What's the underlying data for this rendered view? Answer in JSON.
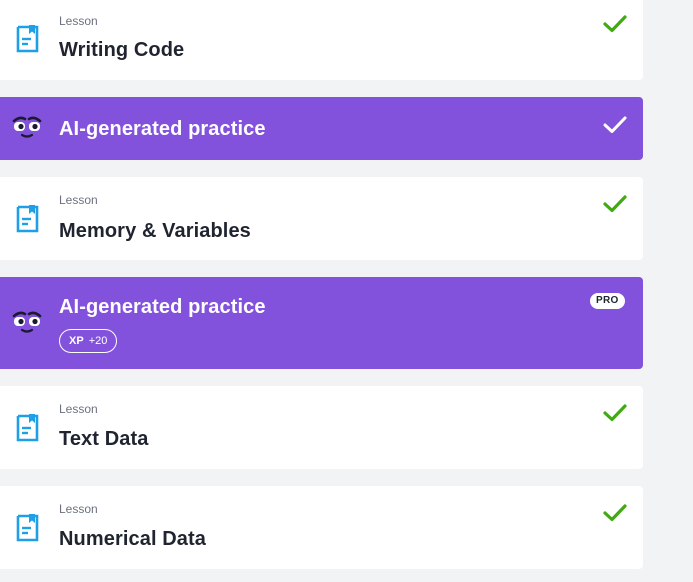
{
  "items": [
    {
      "kind": "lesson",
      "kicker": "Lesson",
      "title": "Writing Code",
      "completed": true
    },
    {
      "kind": "practice",
      "title": "AI-generated practice",
      "completed": true
    },
    {
      "kind": "lesson",
      "kicker": "Lesson",
      "title": "Memory & Variables",
      "completed": true
    },
    {
      "kind": "practice",
      "title": "AI-generated practice",
      "badge": "PRO",
      "xp_label": "XP",
      "xp_value": "+20"
    },
    {
      "kind": "lesson",
      "kicker": "Lesson",
      "title": "Text Data",
      "completed": true
    },
    {
      "kind": "lesson",
      "kicker": "Lesson",
      "title": "Numerical Data",
      "completed": true
    }
  ],
  "colors": {
    "accent_purple": "#8352dd",
    "check_green": "#41a912",
    "icon_blue": "#1fa0e6",
    "background": "#f2f3f5"
  },
  "icons": {
    "lesson": "document-icon",
    "practice": "robot-face-icon",
    "completed": "check-icon"
  }
}
